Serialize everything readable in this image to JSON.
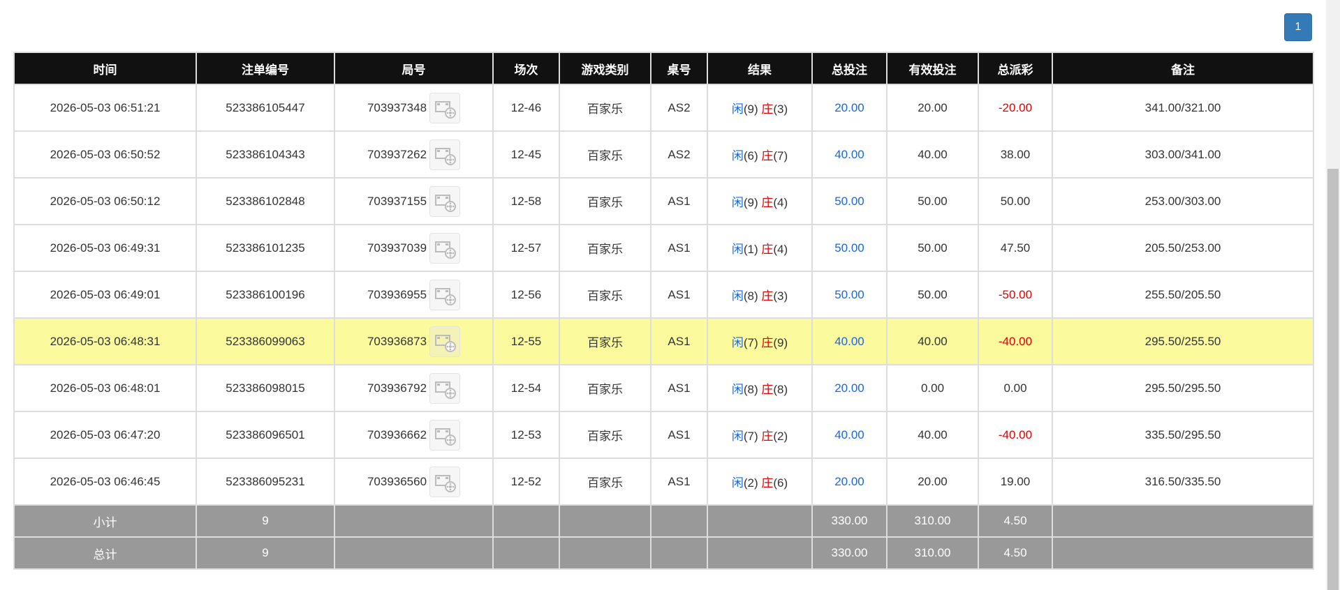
{
  "pagination": {
    "current_page": "1"
  },
  "table": {
    "headers": [
      "时间",
      "注单编号",
      "局号",
      "场次",
      "游戏类别",
      "桌号",
      "结果",
      "总投注",
      "有效投注",
      "总派彩",
      "备注"
    ],
    "rows": [
      {
        "time": "2026-05-03 06:51:21",
        "bet_id": "523386105447",
        "round": "703937348",
        "session": "12-46",
        "game": "百家乐",
        "table": "AS2",
        "player_label": "闲",
        "player_score": "(9)",
        "banker_label": "庄",
        "banker_score": "(3)",
        "total_bet": "20.00",
        "valid_bet": "20.00",
        "payout": "-20.00",
        "payout_negative": true,
        "note": "341.00/321.00"
      },
      {
        "time": "2026-05-03 06:50:52",
        "bet_id": "523386104343",
        "round": "703937262",
        "session": "12-45",
        "game": "百家乐",
        "table": "AS2",
        "player_label": "闲",
        "player_score": "(6)",
        "banker_label": "庄",
        "banker_score": "(7)",
        "total_bet": "40.00",
        "valid_bet": "40.00",
        "payout": "38.00",
        "payout_negative": false,
        "note": "303.00/341.00"
      },
      {
        "time": "2026-05-03 06:50:12",
        "bet_id": "523386102848",
        "round": "703937155",
        "session": "12-58",
        "game": "百家乐",
        "table": "AS1",
        "player_label": "闲",
        "player_score": "(9)",
        "banker_label": "庄",
        "banker_score": "(4)",
        "total_bet": "50.00",
        "valid_bet": "50.00",
        "payout": "50.00",
        "payout_negative": false,
        "note": "253.00/303.00"
      },
      {
        "time": "2026-05-03 06:49:31",
        "bet_id": "523386101235",
        "round": "703937039",
        "session": "12-57",
        "game": "百家乐",
        "table": "AS1",
        "player_label": "闲",
        "player_score": "(1)",
        "banker_label": "庄",
        "banker_score": "(4)",
        "total_bet": "50.00",
        "valid_bet": "50.00",
        "payout": "47.50",
        "payout_negative": false,
        "note": "205.50/253.00"
      },
      {
        "time": "2026-05-03 06:49:01",
        "bet_id": "523386100196",
        "round": "703936955",
        "session": "12-56",
        "game": "百家乐",
        "table": "AS1",
        "player_label": "闲",
        "player_score": "(8)",
        "banker_label": "庄",
        "banker_score": "(3)",
        "total_bet": "50.00",
        "valid_bet": "50.00",
        "payout": "-50.00",
        "payout_negative": true,
        "note": "255.50/205.50"
      },
      {
        "time": "2026-05-03 06:48:31",
        "bet_id": "523386099063",
        "round": "703936873",
        "session": "12-55",
        "game": "百家乐",
        "table": "AS1",
        "player_label": "闲",
        "player_score": "(7)",
        "banker_label": "庄",
        "banker_score": "(9)",
        "total_bet": "40.00",
        "valid_bet": "40.00",
        "payout": "-40.00",
        "payout_negative": true,
        "note": "295.50/255.50",
        "highlighted": true
      },
      {
        "time": "2026-05-03 06:48:01",
        "bet_id": "523386098015",
        "round": "703936792",
        "session": "12-54",
        "game": "百家乐",
        "table": "AS1",
        "player_label": "闲",
        "player_score": "(8)",
        "banker_label": "庄",
        "banker_score": "(8)",
        "total_bet": "20.00",
        "valid_bet": "0.00",
        "payout": "0.00",
        "payout_negative": false,
        "note": "295.50/295.50"
      },
      {
        "time": "2026-05-03 06:47:20",
        "bet_id": "523386096501",
        "round": "703936662",
        "session": "12-53",
        "game": "百家乐",
        "table": "AS1",
        "player_label": "闲",
        "player_score": "(7)",
        "banker_label": "庄",
        "banker_score": "(2)",
        "total_bet": "40.00",
        "valid_bet": "40.00",
        "payout": "-40.00",
        "payout_negative": true,
        "note": "335.50/295.50"
      },
      {
        "time": "2026-05-03 06:46:45",
        "bet_id": "523386095231",
        "round": "703936560",
        "session": "12-52",
        "game": "百家乐",
        "table": "AS1",
        "player_label": "闲",
        "player_score": "(2)",
        "banker_label": "庄",
        "banker_score": "(6)",
        "total_bet": "20.00",
        "valid_bet": "20.00",
        "payout": "19.00",
        "payout_negative": false,
        "note": "316.50/335.50"
      }
    ],
    "subtotal": {
      "label": "小计",
      "count": "9",
      "total_bet": "330.00",
      "valid_bet": "310.00",
      "payout": "4.50"
    },
    "grand_total": {
      "label": "总计",
      "count": "9",
      "total_bet": "330.00",
      "valid_bet": "310.00",
      "payout": "4.50"
    }
  },
  "colors": {
    "header_bg": "#111111",
    "highlight_row": "#fbfb9e",
    "footer_bg": "#999999",
    "player_blue": "#1a66e0",
    "negative_red": "#e00000",
    "pagination_blue": "#337ab7"
  },
  "icons": {
    "round_video": "video-replay-icon"
  }
}
